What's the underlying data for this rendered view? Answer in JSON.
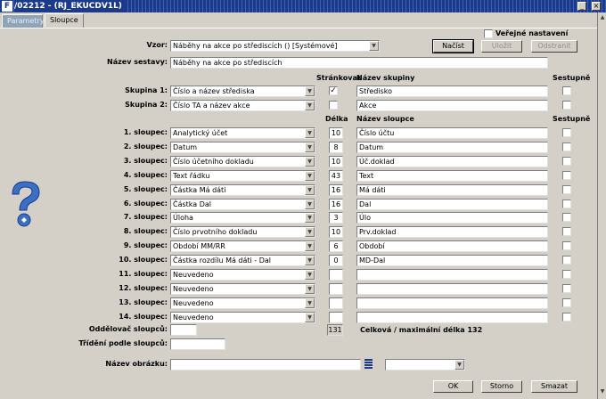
{
  "window": {
    "title": "/02212 - (RJ_EKUCDV1L)"
  },
  "tabs": [
    {
      "label": "Parametry"
    },
    {
      "label": "Sloupce"
    }
  ],
  "public_label": "Veřejné nastavení",
  "vzor": {
    "label": "Vzor:",
    "value": "Náběhy na akce po střediscích   ()   [Systémové]"
  },
  "buttons": {
    "load": "Načíst",
    "save": "Uložit",
    "delete": "Odstranit",
    "ok": "OK",
    "cancel": "Storno",
    "erase": "Smazat"
  },
  "nazev_sestavy": {
    "label": "Název sestavy:",
    "value": "Náběhy na akce po střediscích"
  },
  "group_headers": {
    "strankovat": "Stránkovat",
    "nazev_skupiny": "Název skupiny",
    "sestupne": "Sestupně"
  },
  "groups": [
    {
      "label": "Skupina 1:",
      "value": "Číslo a název střediska",
      "page": "✓",
      "name": "Středisko"
    },
    {
      "label": "Skupina 2:",
      "value": "Číslo TA a název akce",
      "page": "",
      "name": "Akce"
    }
  ],
  "col_headers": {
    "delka": "Délka",
    "nazev_sloupce": "Název sloupce",
    "sestupne": "Sestupně"
  },
  "columns": [
    {
      "label": "1. sloupec:",
      "value": "Analytický účet",
      "len": "10",
      "name": "Číslo účtu"
    },
    {
      "label": "2. sloupec:",
      "value": "Datum",
      "len": "8",
      "name": "Datum"
    },
    {
      "label": "3. sloupec:",
      "value": "Číslo účetního dokladu",
      "len": "10",
      "name": "Úč.doklad"
    },
    {
      "label": "4. sloupec:",
      "value": "Text řádku",
      "len": "43",
      "name": "Text"
    },
    {
      "label": "5. sloupec:",
      "value": "Částka Má dáti",
      "len": "16",
      "name": "Má dáti"
    },
    {
      "label": "6. sloupec:",
      "value": "Částka Dal",
      "len": "16",
      "name": "Dal"
    },
    {
      "label": "7. sloupec:",
      "value": "Úloha",
      "len": "3",
      "name": "Úlo"
    },
    {
      "label": "8. sloupec:",
      "value": "Číslo prvotního dokladu",
      "len": "10",
      "name": "Prv.doklad"
    },
    {
      "label": "9. sloupec:",
      "value": "Období MM/RR",
      "len": "6",
      "name": "Období"
    },
    {
      "label": "10. sloupec:",
      "value": "Částka rozdílu Má dáti - Dal",
      "len": "0",
      "name": "MD-Dal"
    },
    {
      "label": "11. sloupec:",
      "value": "Neuvedeno",
      "len": "",
      "name": ""
    },
    {
      "label": "12. sloupec:",
      "value": "Neuvedeno",
      "len": "",
      "name": ""
    },
    {
      "label": "13. sloupec:",
      "value": "Neuvedeno",
      "len": "",
      "name": ""
    },
    {
      "label": "14. sloupec:",
      "value": "Neuvedeno",
      "len": "",
      "name": ""
    }
  ],
  "oddelovac": {
    "label": "Oddělovač sloupců:",
    "value": ""
  },
  "total": {
    "value": "131",
    "label": "Celková / maximální délka 132"
  },
  "trideni": {
    "label": "Třídění podle sloupců:",
    "value": ""
  },
  "nazev_obrazku": {
    "label": "Název obrázku:",
    "value": ""
  },
  "icons": {
    "app": "oracle-forms-icon",
    "help": "help-question-icon",
    "list": "list-icon"
  }
}
